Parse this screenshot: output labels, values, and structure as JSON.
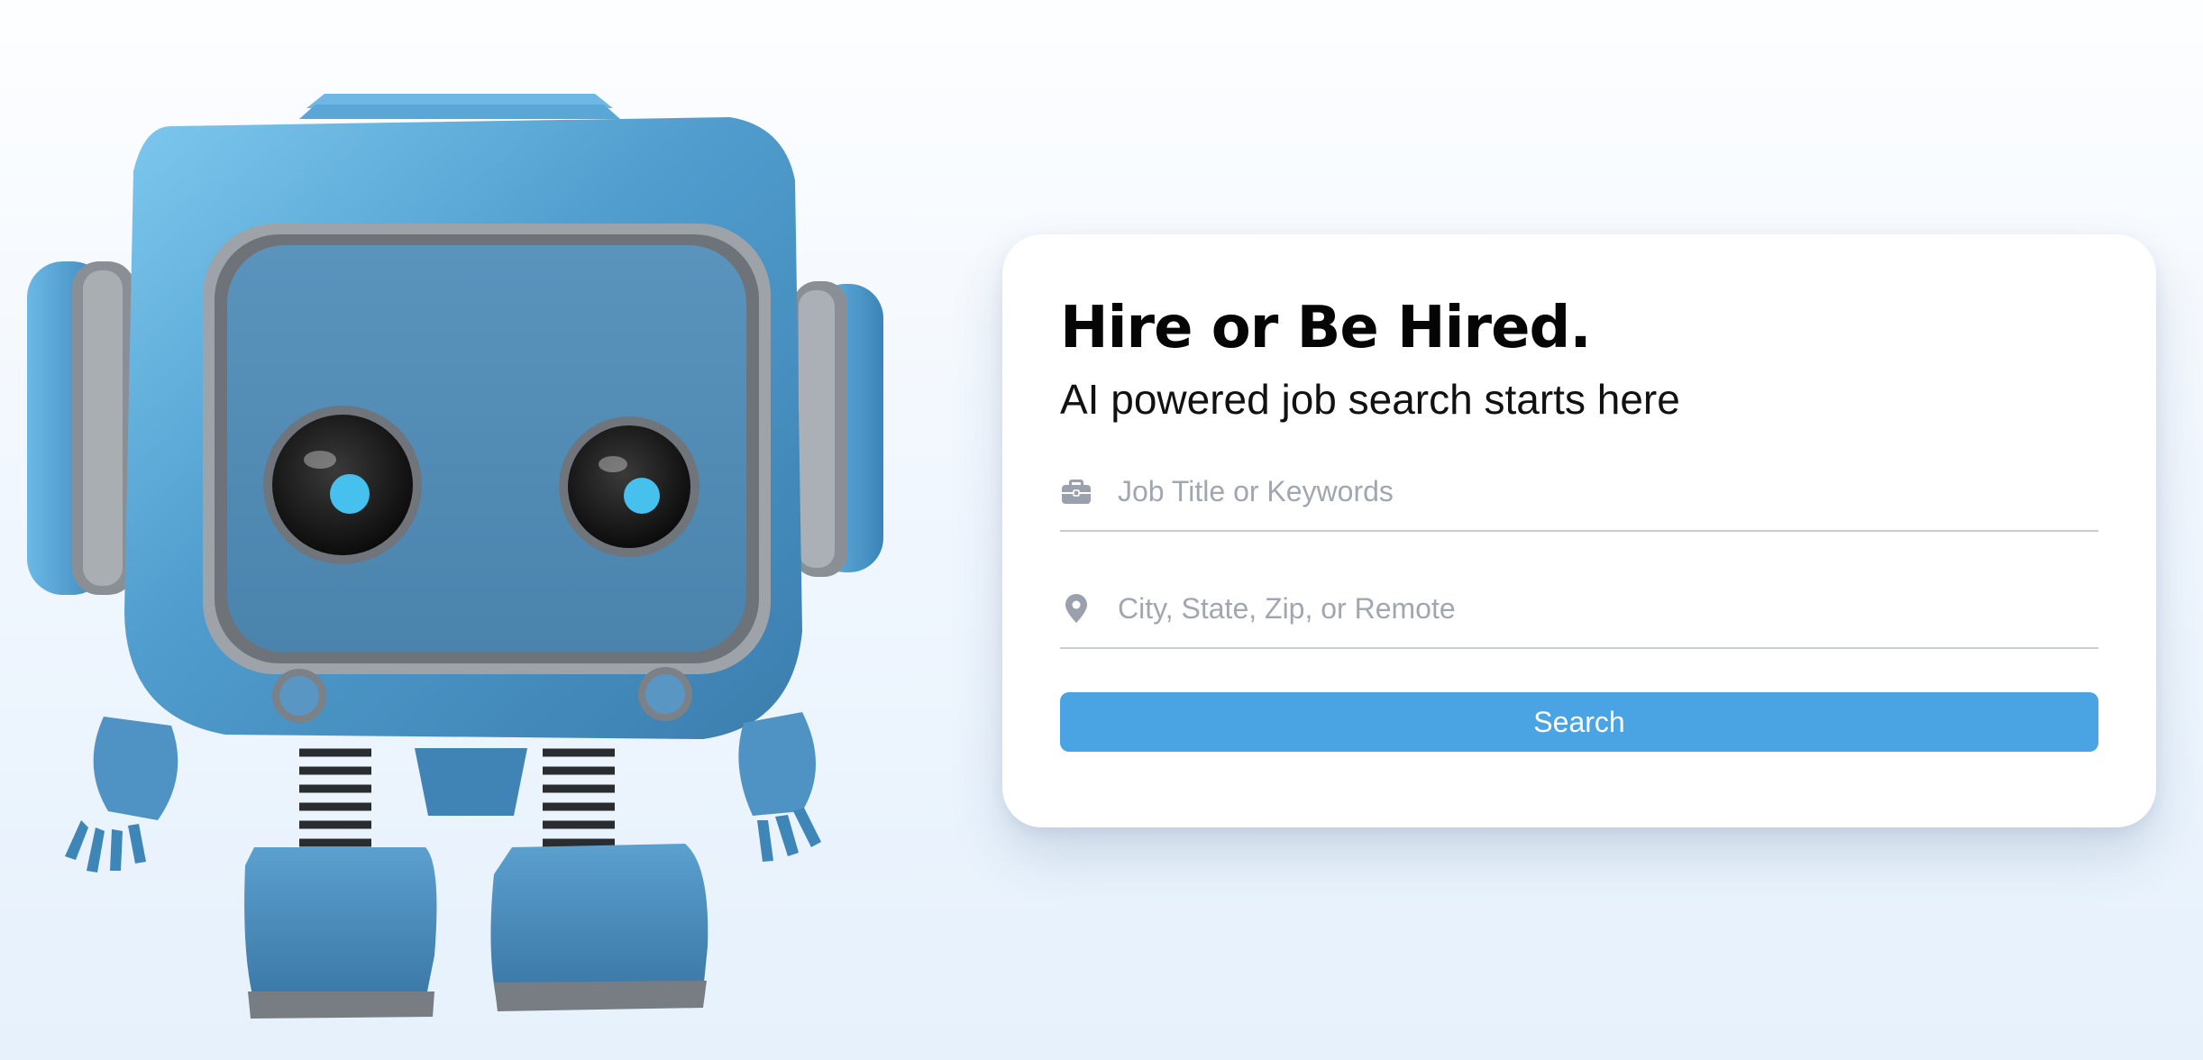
{
  "hero": {
    "title": "Hire or Be Hired.",
    "subtitle": "AI powered job search starts here",
    "illustration": "blue-robot-mascot"
  },
  "search_form": {
    "keywords": {
      "placeholder": "Job Title or Keywords",
      "value": "",
      "icon": "briefcase-icon"
    },
    "location": {
      "placeholder": "City, State, Zip, or Remote",
      "value": "",
      "icon": "map-pin-icon"
    },
    "submit_label": "Search"
  },
  "colors": {
    "accent": "#4aa3e2",
    "robot_body": "#4f93c4",
    "title_text": "#050505",
    "placeholder": "#a1a7b1",
    "icon_gray": "#9aa1ad"
  }
}
